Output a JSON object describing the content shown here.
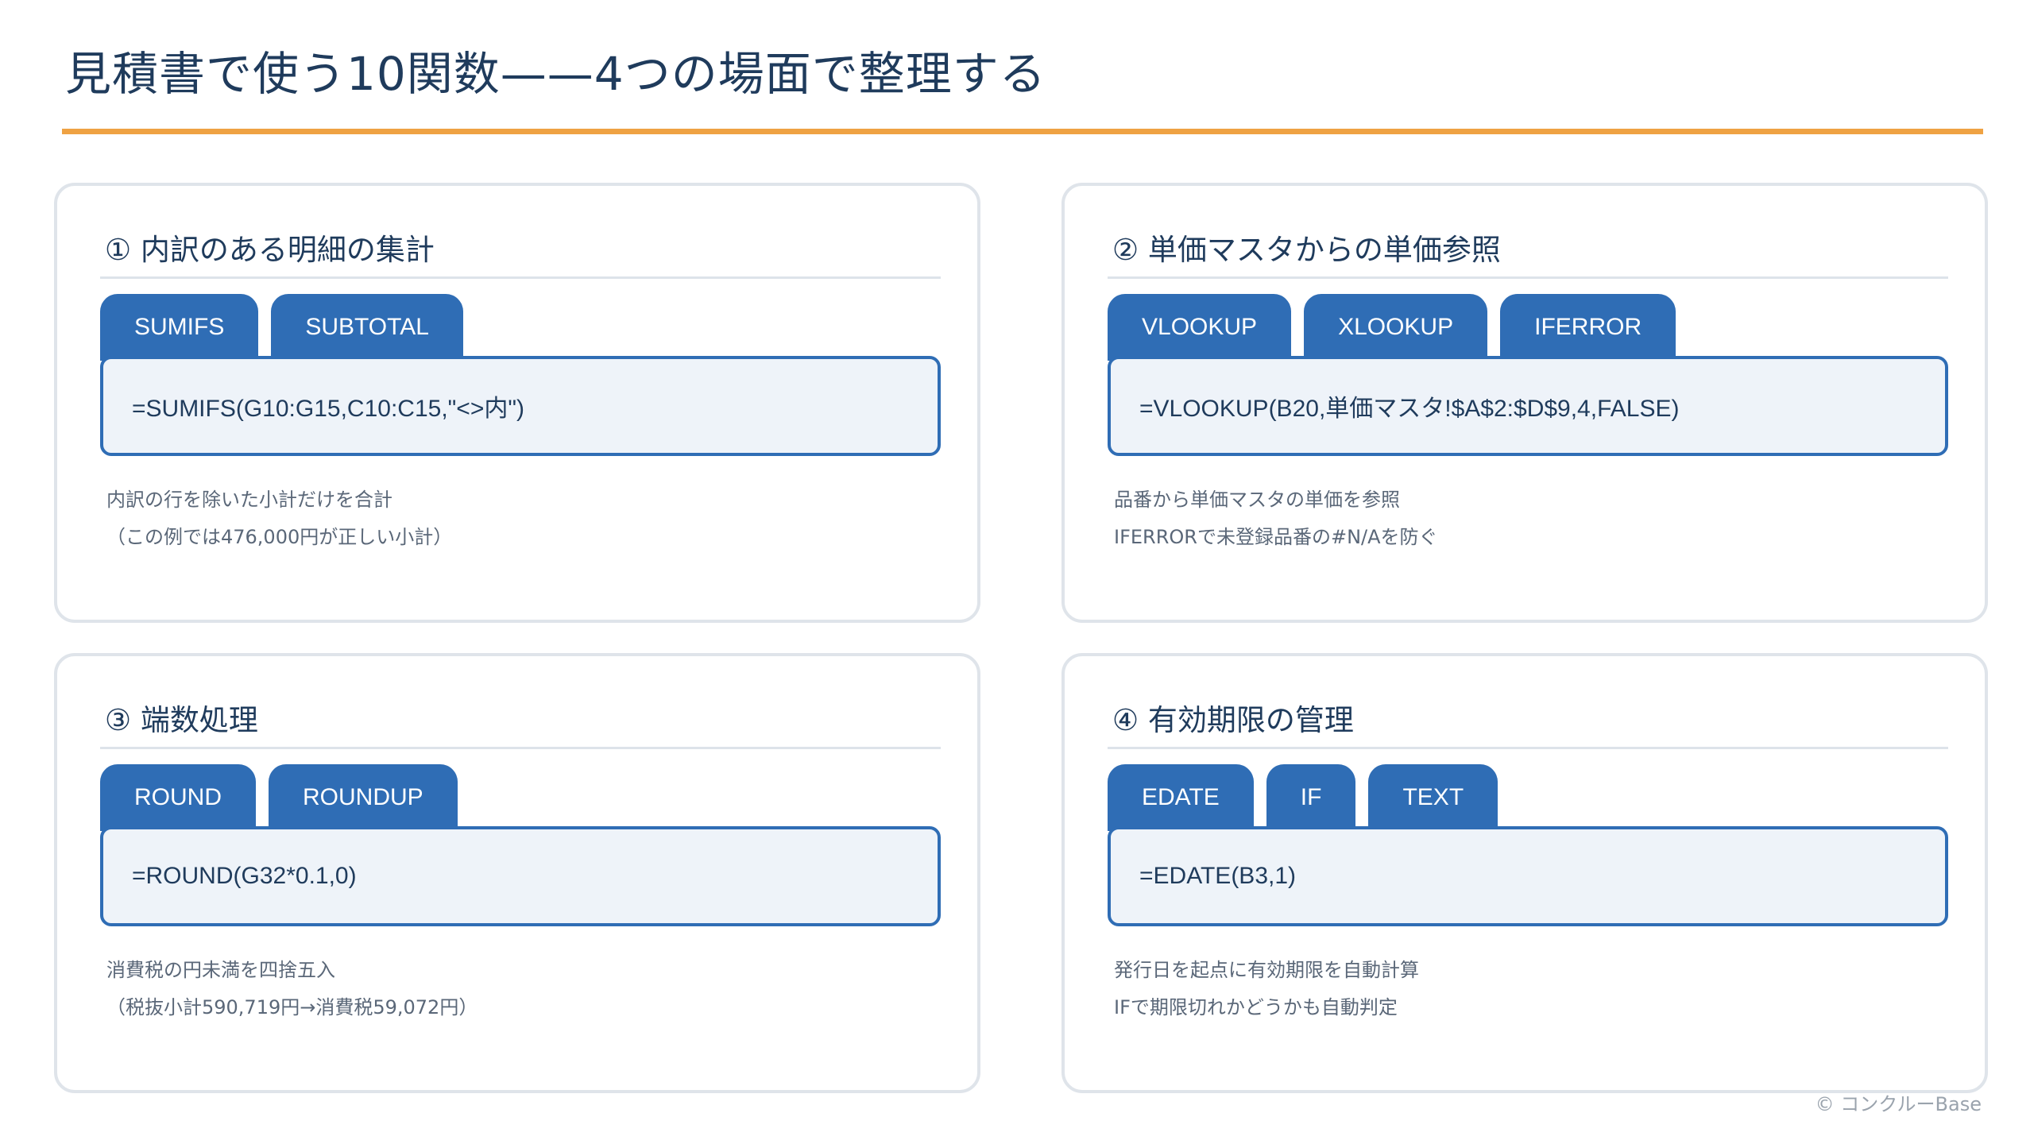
{
  "page": {
    "title": "見積書で使う10関数——4つの場面で整理する",
    "copyright": "© コンクルーBase"
  },
  "colors": {
    "accent_rule": "#efa243",
    "tag_blue": "#2f6db5",
    "code_bg": "#eef3f9",
    "title_text": "#1f3b5c",
    "card_border": "#dfe4ea"
  },
  "cards": [
    {
      "heading": "① 内訳のある明細の集計",
      "tags": [
        "SUMIFS",
        "SUBTOTAL"
      ],
      "formula": "=SUMIFS(G10:G15,C10:C15,\"<>内\")",
      "description": [
        "内訳の行を除いた小計だけを合計",
        "（この例では476,000円が正しい小計）"
      ]
    },
    {
      "heading": "② 単価マスタからの単価参照",
      "tags": [
        "VLOOKUP",
        "XLOOKUP",
        "IFERROR"
      ],
      "formula": "=VLOOKUP(B20,単価マスタ!$A$2:$D$9,4,FALSE)",
      "description": [
        "品番から単価マスタの単価を参照",
        "IFERRORで未登録品番の#N/Aを防ぐ"
      ]
    },
    {
      "heading": "③ 端数処理",
      "tags": [
        "ROUND",
        "ROUNDUP"
      ],
      "formula": "=ROUND(G32*0.1,0)",
      "description": [
        "消費税の円未満を四捨五入",
        "（税抜小計590,719円→消費税59,072円）"
      ]
    },
    {
      "heading": "④ 有効期限の管理",
      "tags": [
        "EDATE",
        "IF",
        "TEXT"
      ],
      "formula": "=EDATE(B3,1)",
      "description": [
        "発行日を起点に有効期限を自動計算",
        "IFで期限切れかどうかも自動判定"
      ]
    }
  ]
}
